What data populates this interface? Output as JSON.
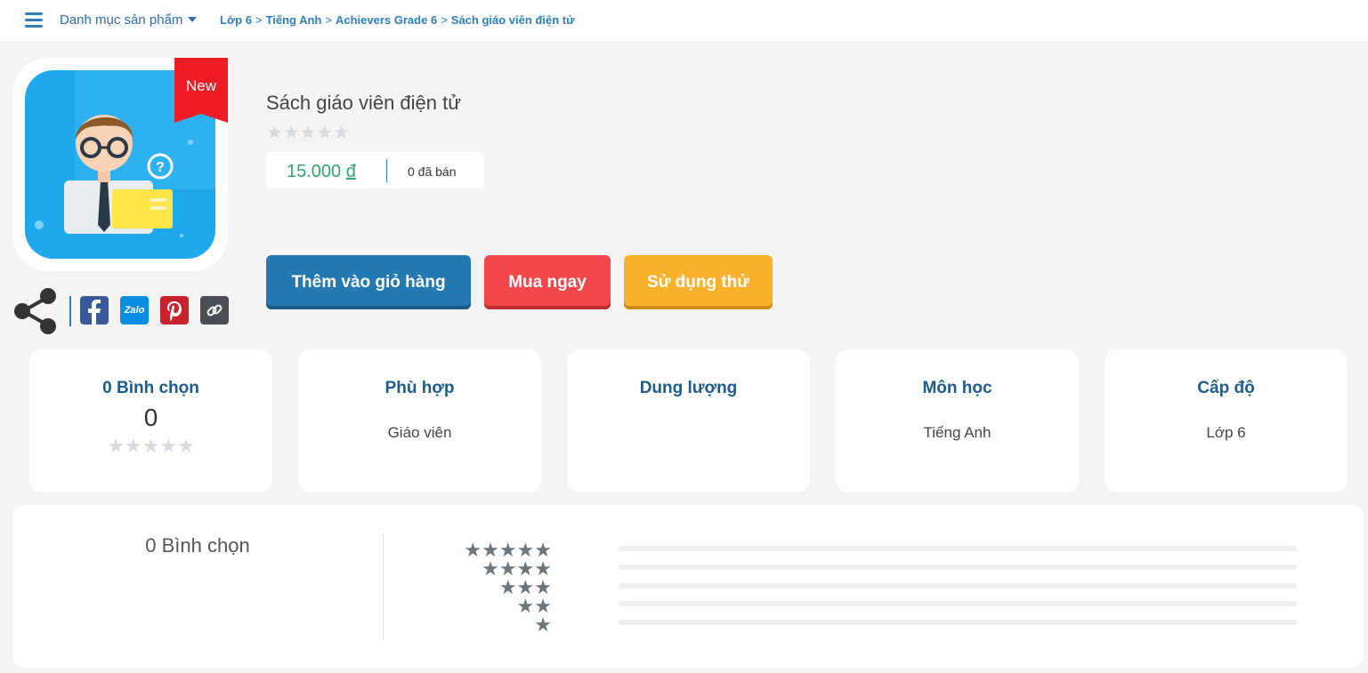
{
  "nav": {
    "menu_label": "Danh mục sản phẩm",
    "breadcrumbs": [
      "Lớp 6",
      "Tiếng Anh",
      "Achievers Grade 6",
      "Sách giáo viên điện tử"
    ]
  },
  "product": {
    "badge": "New",
    "title": "Sách giáo viên điện tử",
    "rating_stars": "★★★★★",
    "rating_value": 0,
    "price_amount": "15.000",
    "price_currency": "đ",
    "sold": "0 đã bán"
  },
  "share": {
    "zalo_label": "Zalo"
  },
  "actions": {
    "add_to_cart": "Thêm vào giỏ hàng",
    "buy_now": "Mua ngay",
    "try_it": "Sử dụng thử"
  },
  "info_cards": {
    "votes_title": "0 Bình chọn",
    "votes_value": "0",
    "votes_stars": "★★★★★",
    "fit_title": "Phù hợp",
    "fit_value": "Giáo viên",
    "size_title": "Dung lượng",
    "size_value": "",
    "subject_title": "Môn học",
    "subject_value": "Tiếng Anh",
    "level_title": "Cấp độ",
    "level_value": "Lớp 6"
  },
  "reviews": {
    "summary": "0 Bình chọn",
    "rows": [
      {
        "stars": "★★★★★",
        "share": 0
      },
      {
        "stars": "★★★★",
        "share": 0
      },
      {
        "stars": "★★★",
        "share": 0
      },
      {
        "stars": "★★",
        "share": 0
      },
      {
        "stars": "★",
        "share": 0
      }
    ]
  },
  "colors": {
    "brand_blue": "#2579b3",
    "buy_red": "#f2474a",
    "try_orange": "#fdb22d",
    "price_green": "#2ea86b",
    "new_badge": "#ee1c24"
  }
}
